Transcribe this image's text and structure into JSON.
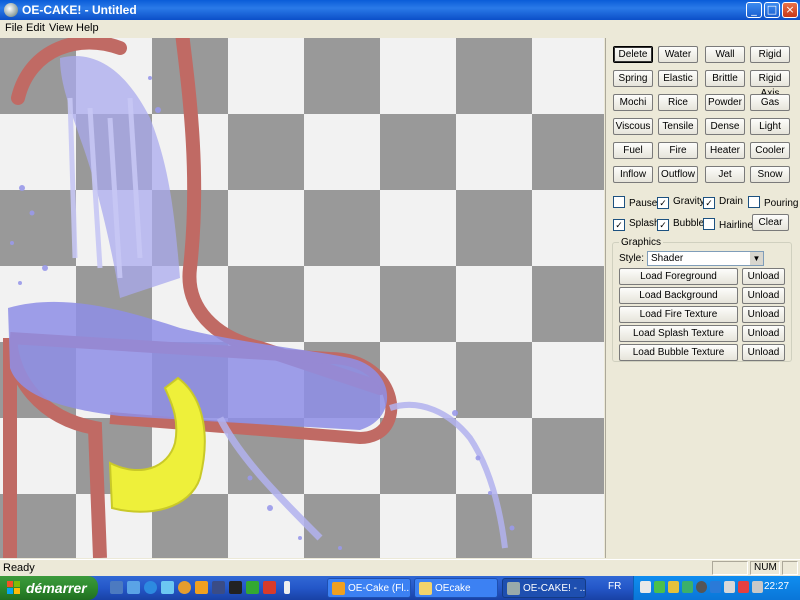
{
  "window": {
    "title": "OE-CAKE! - Untitled"
  },
  "menu": [
    "File",
    "Edit",
    "View",
    "Help"
  ],
  "tools": {
    "rows": [
      [
        "Delete",
        "Water",
        "Wall",
        "Rigid"
      ],
      [
        "Spring",
        "Elastic",
        "Brittle",
        "Rigid Axis"
      ],
      [
        "Mochi",
        "Rice",
        "Powder",
        "Gas"
      ],
      [
        "Viscous",
        "Tensile",
        "Dense",
        "Light"
      ],
      [
        "Fuel",
        "Fire",
        "Heater",
        "Cooler"
      ],
      [
        "Inflow",
        "Outflow",
        "Jet",
        "Snow"
      ]
    ],
    "selected": "Delete"
  },
  "options": {
    "pause": {
      "label": "Pause",
      "checked": false
    },
    "gravity": {
      "label": "Gravity",
      "checked": true
    },
    "drain": {
      "label": "Drain",
      "checked": true
    },
    "pouring": {
      "label": "Pouring",
      "checked": false
    },
    "splash": {
      "label": "Splash",
      "checked": true
    },
    "bubble": {
      "label": "Bubble",
      "checked": true
    },
    "hairline": {
      "label": "Hairline",
      "checked": false
    },
    "clear_label": "Clear"
  },
  "graphics": {
    "title": "Graphics",
    "style_label": "Style:",
    "style_value": "Shader",
    "loads": [
      {
        "label": "Load Foreground",
        "unload": "Unload"
      },
      {
        "label": "Load Background",
        "unload": "Unload"
      },
      {
        "label": "Load Fire Texture",
        "unload": "Unload"
      },
      {
        "label": "Load Splash Texture",
        "unload": "Unload"
      },
      {
        "label": "Load Bubble Texture",
        "unload": "Unload"
      }
    ]
  },
  "status": {
    "text": "Ready",
    "num": "NUM"
  },
  "taskbar": {
    "start_label": "démarrer",
    "tasks": [
      {
        "label": "OE-Cake (Fl...",
        "active": false
      },
      {
        "label": "OEcake",
        "active": false
      },
      {
        "label": "OE-CAKE! - ...",
        "active": true
      }
    ],
    "lang": "FR",
    "clock": "22:27"
  },
  "colors": {
    "wall": "#c06a64",
    "water": "#8e8ee6",
    "rigid_yellow": "#eef03a",
    "checker_dark": "#999999",
    "checker_light": "#f2f2f2"
  }
}
